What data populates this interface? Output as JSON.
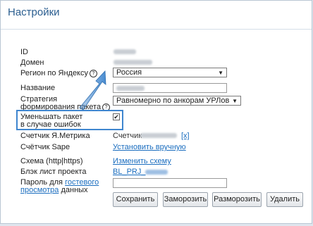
{
  "title": "Настройки",
  "colors": {
    "accent": "#2a5d8f",
    "link": "#1a6dbf",
    "highlight": "#3f86cf"
  },
  "labels": {
    "id": "ID",
    "domain": "Домен",
    "region": "Регион по Яндексу",
    "name": "Название",
    "strategy_line1": "Стратегия",
    "strategy_line2": "формирования пакета",
    "reduce_line1": "Уменьшать пакет",
    "reduce_line2": "в случае ошибок",
    "metrika": "Счетчик Я.Метрика",
    "sape": "Счётчик Sape",
    "scheme": "Схема (http|https)",
    "blacklist": "Блэк лист проекта",
    "guest_prefix": "Пароль для",
    "guest_link1": "гостевого",
    "guest_link2": "просмотра",
    "guest_suffix": "данных"
  },
  "values": {
    "region_selected": "Россия",
    "strategy_selected": "Равномерно по анкорам УРЛов",
    "metrika_prefix": "Счетчик",
    "metrika_remove": "[x]",
    "sape_link": "Установить вручную",
    "scheme_link": "Изменить схему",
    "blacklist_link_prefix": "BL_PRJ_"
  },
  "icons": {
    "help": "?",
    "checkmark": "✔",
    "dropdown": "▼"
  },
  "buttons": {
    "save": "Сохранить",
    "freeze": "Заморозить",
    "unfreeze": "Разморозить",
    "delete": "Удалить"
  }
}
